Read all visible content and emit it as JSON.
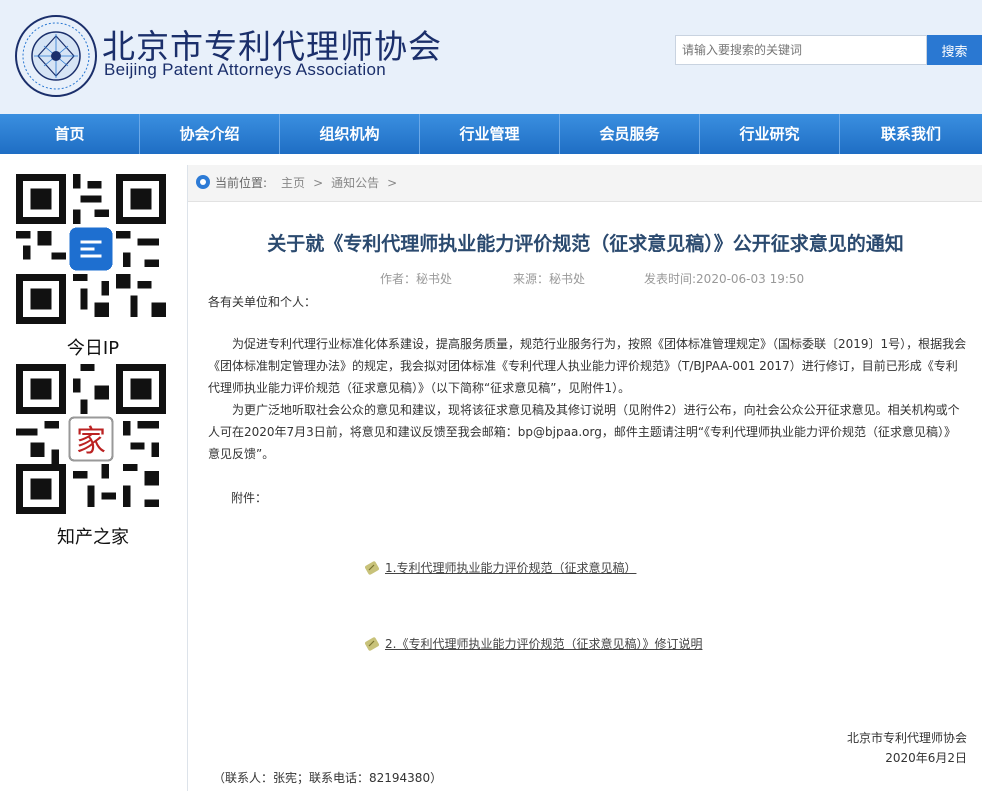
{
  "header": {
    "org_name_cn": "北京市专利代理师协会",
    "org_name_en": "Beijing Patent Attorneys Association",
    "search": {
      "placeholder": "请输入要搜索的关键词",
      "button_label": "搜索"
    }
  },
  "nav": {
    "items": [
      "首页",
      "协会介绍",
      "组织机构",
      "行业管理",
      "会员服务",
      "行业研究",
      "联系我们"
    ]
  },
  "sidebar": {
    "qr1_caption": "今日IP",
    "qr2_caption": "知产之家"
  },
  "breadcrumb": {
    "label": "当前位置:",
    "items": [
      "主页",
      "通知公告"
    ],
    "separator": ">"
  },
  "article": {
    "title": "关于就《专利代理师执业能力评价规范（征求意见稿）》公开征求意见的通知",
    "author_label": "作者：秘书处",
    "source_label": "来源：秘书处",
    "time_label": "发表时间:2020-06-03 19:50",
    "greeting": "各有关单位和个人：",
    "paragraph1": "为促进专利代理行业标准化体系建设，提高服务质量，规范行业服务行为，按照《团体标准管理规定》（国标委联〔2019〕1号），根据我会《团体标准制定管理办法》的规定，我会拟对团体标准《专利代理人执业能力评价规范》（T/BJPAA-001 2017）进行修订，目前已形成《专利代理师执业能力评价规范（征求意见稿）》（以下简称“征求意见稿”，见附件1）。",
    "paragraph2": "为更广泛地听取社会公众的意见和建议，现将该征求意见稿及其修订说明（见附件2）进行公布，向社会公众公开征求意见。相关机构或个人可在2020年7月3日前，将意见和建议反馈至我会邮箱：bp@bjpaa.org，邮件主题请注明“《专利代理师执业能力评价规范（征求意见稿）》意见反馈”。",
    "attach_label": "附件：",
    "attachments": [
      "1.专利代理师执业能力评价规范（征求意见稿）",
      "2.《专利代理师执业能力评价规范（征求意见稿）》修订说明"
    ],
    "sign_org": "北京市专利代理师协会",
    "sign_date": "2020年6月2日",
    "contact": "（联系人：张宪；联系电话：82194380）"
  },
  "colors": {
    "nav_blue": "#1f6ec4",
    "title_blue": "#2b4a6f",
    "header_bg": "#e8f0fa"
  }
}
